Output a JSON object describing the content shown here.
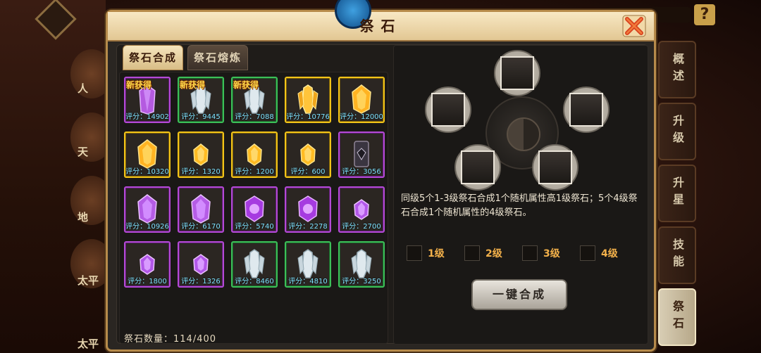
{
  "background": {
    "left_labels": [
      "人",
      "天",
      "地",
      "太平",
      "太平"
    ]
  },
  "help_label": "?",
  "dialog": {
    "title": "祭石",
    "tabs": [
      {
        "label": "祭石合成",
        "active": true
      },
      {
        "label": "祭石熔炼",
        "active": false
      }
    ],
    "new_label": "新获得",
    "stone_count_label": "祭石数量：114/400",
    "stones": [
      {
        "score": "评分：14902",
        "rarity": "purple",
        "gem": "purple-crystal",
        "is_new": true
      },
      {
        "score": "评分：9445",
        "rarity": "green",
        "gem": "white-crystal",
        "is_new": true
      },
      {
        "score": "评分：7088",
        "rarity": "green",
        "gem": "white-crystal",
        "is_new": true
      },
      {
        "score": "评分：10776",
        "rarity": "gold",
        "gem": "gold-crystal",
        "is_new": false
      },
      {
        "score": "评分：12000",
        "rarity": "gold",
        "gem": "gold-rune",
        "is_new": false
      },
      {
        "score": "评分：10320",
        "rarity": "gold",
        "gem": "gold-rune",
        "is_new": false
      },
      {
        "score": "评分：1320",
        "rarity": "gold",
        "gem": "gold-gem",
        "is_new": false
      },
      {
        "score": "评分：1200",
        "rarity": "gold",
        "gem": "gold-gem",
        "is_new": false
      },
      {
        "score": "评分：600",
        "rarity": "gold",
        "gem": "gold-gem",
        "is_new": false
      },
      {
        "score": "评分：3056",
        "rarity": "purple",
        "gem": "dark-tablet",
        "is_new": false
      },
      {
        "score": "评分：10926",
        "rarity": "purple",
        "gem": "purple-rune",
        "is_new": false
      },
      {
        "score": "评分：6170",
        "rarity": "purple",
        "gem": "purple-rune",
        "is_new": false
      },
      {
        "score": "评分：5740",
        "rarity": "purple",
        "gem": "purple-orb",
        "is_new": false
      },
      {
        "score": "评分：2278",
        "rarity": "purple",
        "gem": "purple-orb",
        "is_new": false
      },
      {
        "score": "评分：2700",
        "rarity": "purple",
        "gem": "purple-gem",
        "is_new": false
      },
      {
        "score": "评分：1800",
        "rarity": "purple",
        "gem": "purple-gem",
        "is_new": false
      },
      {
        "score": "评分：1326",
        "rarity": "purple",
        "gem": "purple-gem",
        "is_new": false
      },
      {
        "score": "评分：8460",
        "rarity": "green",
        "gem": "white-crystal",
        "is_new": false
      },
      {
        "score": "评分：4810",
        "rarity": "green",
        "gem": "white-crystal",
        "is_new": false
      },
      {
        "score": "评分：3250",
        "rarity": "green",
        "gem": "white-crystal",
        "is_new": false
      }
    ],
    "synth": {
      "description": "同级5个1-3级祭石合成1个随机属性高1级祭石；5个4级祭石合成1个随机属性的4级祭石。",
      "levels": [
        "1级",
        "2级",
        "3级",
        "4级"
      ],
      "one_key_label": "一键合成"
    }
  },
  "right_tabs": [
    {
      "label": "概述",
      "active": false
    },
    {
      "label": "升级",
      "active": false
    },
    {
      "label": "升星",
      "active": false
    },
    {
      "label": "技能",
      "active": false
    },
    {
      "label": "祭石",
      "active": true
    }
  ],
  "colors": {
    "rarity_purple": "#b44ad6",
    "rarity_green": "#3cbf58",
    "rarity_gold": "#f2c419",
    "score_text": "#7fe3ff",
    "level_text": "#f2b04a"
  }
}
